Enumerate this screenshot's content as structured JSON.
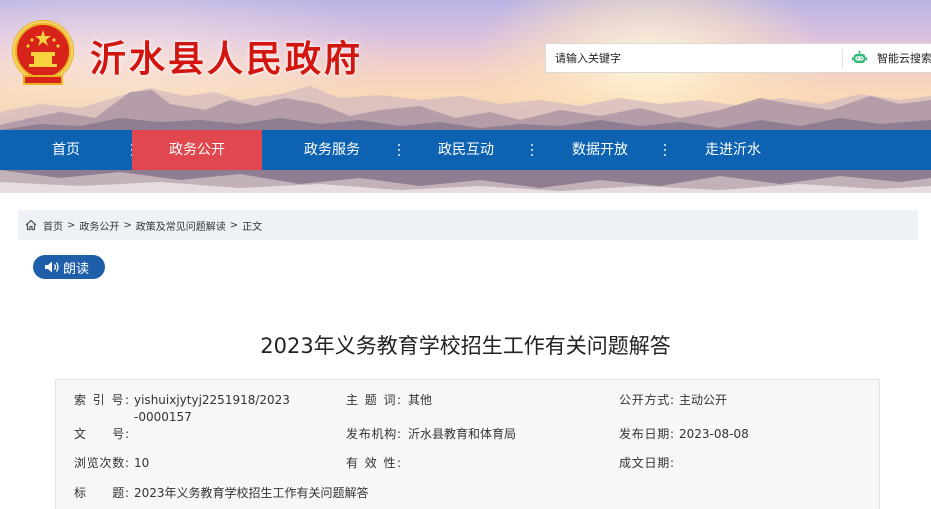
{
  "header": {
    "site_title": "沂水县人民政府",
    "search": {
      "placeholder": "请输入关键字",
      "button_label": "智能云搜索"
    }
  },
  "nav": {
    "items": [
      {
        "label": "首页",
        "active": false
      },
      {
        "label": "政务公开",
        "active": true
      },
      {
        "label": "政务服务",
        "active": false
      },
      {
        "label": "政民互动",
        "active": false
      },
      {
        "label": "数据开放",
        "active": false
      },
      {
        "label": "走进沂水",
        "active": false
      }
    ]
  },
  "breadcrumb": {
    "items": [
      "首页",
      "政务公开",
      "政策及常见问题解读",
      "正文"
    ],
    "separator": ">"
  },
  "read_button": {
    "label": "朗读"
  },
  "article": {
    "title": "2023年义务教育学校招生工作有关问题解答"
  },
  "info": {
    "index_label": "索 引 号:",
    "index_value": "yishuixjytyj2251918/2023-0000157",
    "subject_label": "主 题 词:",
    "subject_value": "其他",
    "public_mode_label": "公开方式:",
    "public_mode_value": "主动公开",
    "doc_no_label": "文　　号:",
    "doc_no_value": "",
    "issuer_label": "发布机构:",
    "issuer_value": "沂水县教育和体育局",
    "publish_date_label": "发布日期:",
    "publish_date_value": "2023-08-08",
    "views_label": "浏览次数:",
    "views_value": "10",
    "validity_label": "有 效 性:",
    "validity_value": "",
    "created_date_label": "成文日期:",
    "created_date_value": "",
    "title_label": "标　　题:",
    "title_value": "2023年义务教育学校招生工作有关问题解答"
  },
  "colors": {
    "nav_bg": "#0d63b1",
    "nav_active": "#e0474e",
    "title_red": "#d3150f",
    "read_button": "#1f5ea8"
  }
}
